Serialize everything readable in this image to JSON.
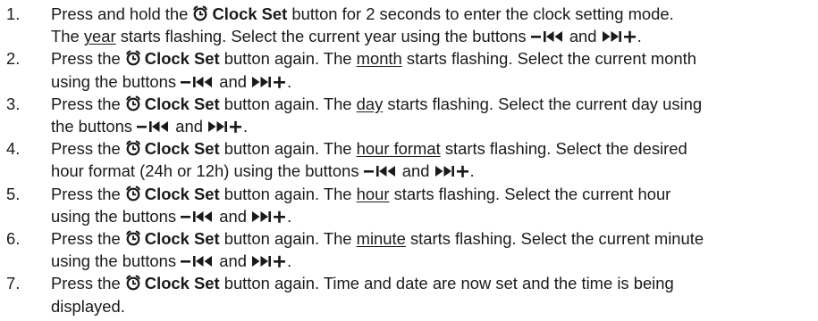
{
  "steps": [
    {
      "num": "1.",
      "parts": [
        {
          "t": "text",
          "v": "Press and hold the "
        },
        {
          "t": "icon"
        },
        {
          "t": "bold",
          "v": "Clock Set"
        },
        {
          "t": "text",
          "v": " button for 2 seconds to enter the clock setting mode."
        },
        {
          "t": "br"
        },
        {
          "t": "text",
          "v": "The "
        },
        {
          "t": "u",
          "v": "year"
        },
        {
          "t": "text",
          "v": " starts flashing. Select the current year using the buttons "
        },
        {
          "t": "prev"
        },
        {
          "t": "text",
          "v": " and "
        },
        {
          "t": "next"
        },
        {
          "t": "text",
          "v": "."
        }
      ]
    },
    {
      "num": "2.",
      "parts": [
        {
          "t": "text",
          "v": "Press the "
        },
        {
          "t": "icon"
        },
        {
          "t": "bold",
          "v": "Clock Set"
        },
        {
          "t": "text",
          "v": " button again. The "
        },
        {
          "t": "u",
          "v": "month"
        },
        {
          "t": "text",
          "v": " starts flashing. Select the current month"
        },
        {
          "t": "br"
        },
        {
          "t": "text",
          "v": "using the buttons "
        },
        {
          "t": "prev"
        },
        {
          "t": "text",
          "v": " and "
        },
        {
          "t": "next"
        },
        {
          "t": "text",
          "v": "."
        }
      ]
    },
    {
      "num": "3.",
      "parts": [
        {
          "t": "text",
          "v": "Press the "
        },
        {
          "t": "icon"
        },
        {
          "t": "bold",
          "v": "Clock Set"
        },
        {
          "t": "text",
          "v": " button again. The "
        },
        {
          "t": "u",
          "v": "day"
        },
        {
          "t": "text",
          "v": " starts flashing. Select the current day using"
        },
        {
          "t": "br"
        },
        {
          "t": "text",
          "v": "the buttons "
        },
        {
          "t": "prev"
        },
        {
          "t": "text",
          "v": " and "
        },
        {
          "t": "next"
        },
        {
          "t": "text",
          "v": "."
        }
      ]
    },
    {
      "num": "4.",
      "parts": [
        {
          "t": "text",
          "v": "Press the "
        },
        {
          "t": "icon"
        },
        {
          "t": "bold",
          "v": "Clock Set"
        },
        {
          "t": "text",
          "v": " button again. The "
        },
        {
          "t": "u",
          "v": "hour format"
        },
        {
          "t": "text",
          "v": " starts flashing. Select the desired"
        },
        {
          "t": "br"
        },
        {
          "t": "text",
          "v": "hour format (24h or 12h) using the buttons "
        },
        {
          "t": "prev"
        },
        {
          "t": "text",
          "v": " and "
        },
        {
          "t": "next"
        },
        {
          "t": "text",
          "v": "."
        }
      ]
    },
    {
      "num": "5.",
      "parts": [
        {
          "t": "text",
          "v": "Press the "
        },
        {
          "t": "icon"
        },
        {
          "t": "bold",
          "v": "Clock Set"
        },
        {
          "t": "text",
          "v": " button again. The "
        },
        {
          "t": "u",
          "v": "hour"
        },
        {
          "t": "text",
          "v": " starts flashing. Select the current hour"
        },
        {
          "t": "br"
        },
        {
          "t": "text",
          "v": "using the buttons "
        },
        {
          "t": "prev"
        },
        {
          "t": "text",
          "v": " and "
        },
        {
          "t": "next"
        },
        {
          "t": "text",
          "v": "."
        }
      ]
    },
    {
      "num": "6.",
      "parts": [
        {
          "t": "text",
          "v": "Press the "
        },
        {
          "t": "icon"
        },
        {
          "t": "bold",
          "v": "Clock Set"
        },
        {
          "t": "text",
          "v": " button again. The "
        },
        {
          "t": "u",
          "v": "minute"
        },
        {
          "t": "text",
          "v": " starts flashing. Select the current minute"
        },
        {
          "t": "br"
        },
        {
          "t": "text",
          "v": "using the buttons "
        },
        {
          "t": "prev"
        },
        {
          "t": "text",
          "v": " and "
        },
        {
          "t": "next"
        },
        {
          "t": "text",
          "v": "."
        }
      ]
    },
    {
      "num": "7.",
      "parts": [
        {
          "t": "text",
          "v": "Press the "
        },
        {
          "t": "icon"
        },
        {
          "t": "bold",
          "v": "Clock Set"
        },
        {
          "t": "text",
          "v": " button again. Time and date are now set and the time is being"
        },
        {
          "t": "br"
        },
        {
          "t": "text",
          "v": "displayed."
        }
      ]
    }
  ]
}
